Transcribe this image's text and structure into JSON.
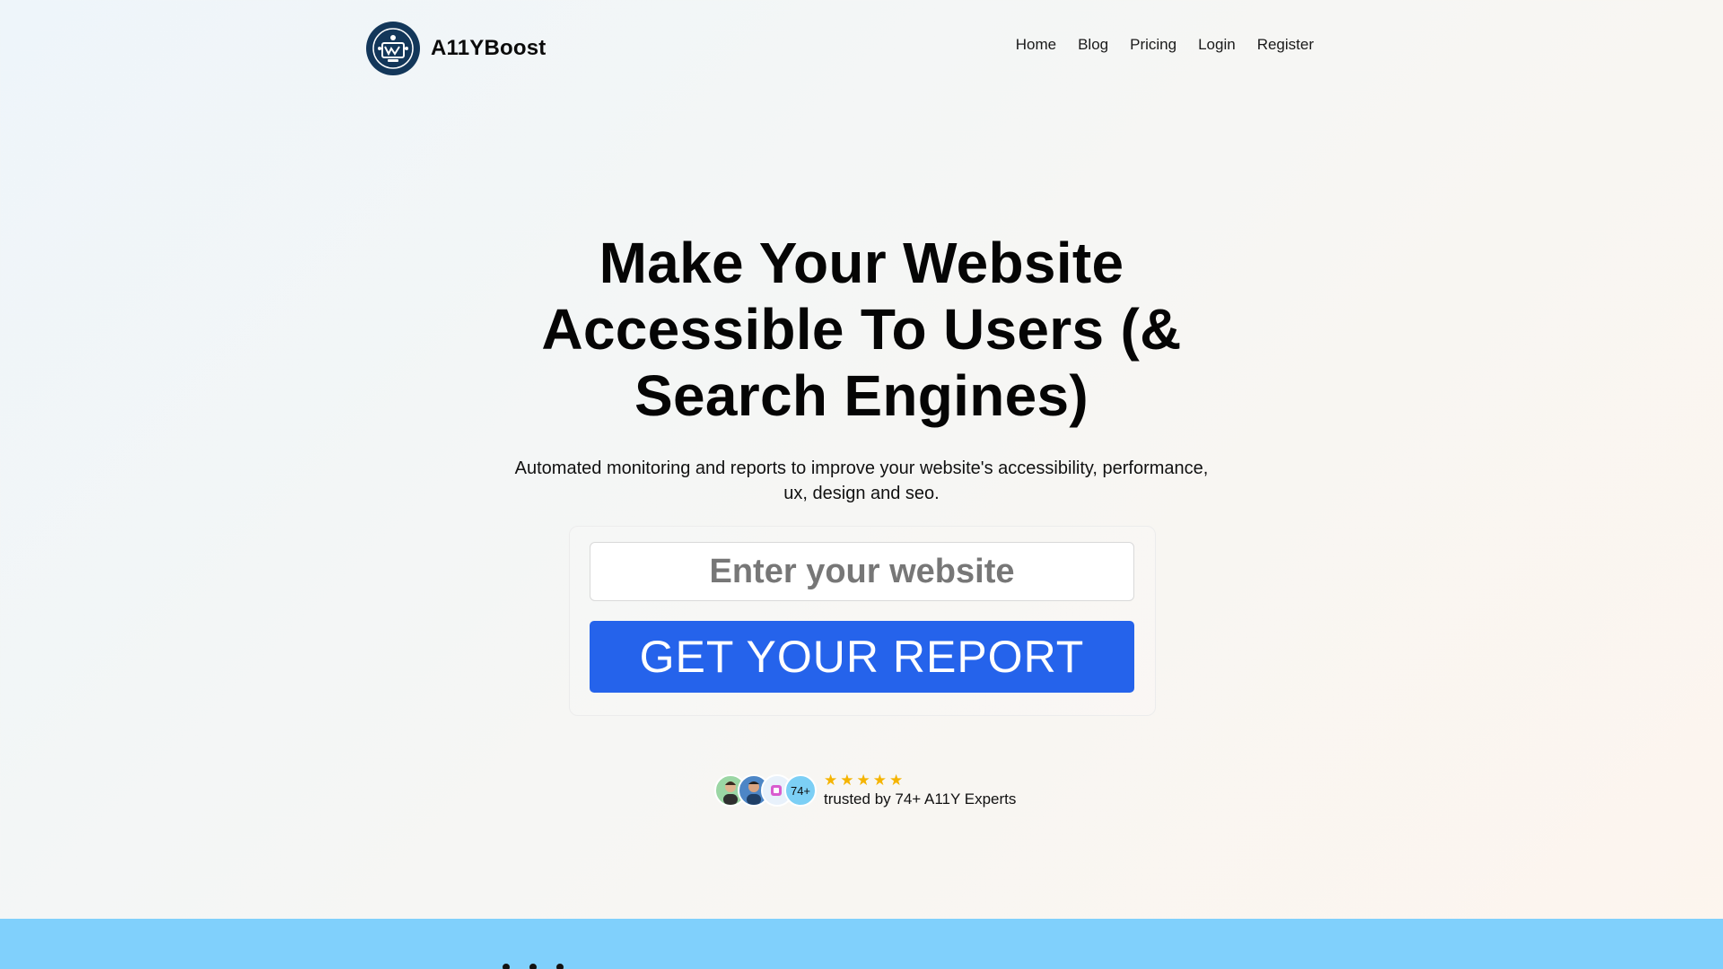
{
  "brand": {
    "name": "A11YBoost",
    "logo_icon": "accessibility-monitor-icon"
  },
  "nav": {
    "items": [
      {
        "label": "Home"
      },
      {
        "label": "Blog"
      },
      {
        "label": "Pricing"
      },
      {
        "label": "Login"
      },
      {
        "label": "Register"
      }
    ]
  },
  "hero": {
    "title": "Make Your Website Accessible To Users (& Search Engines)",
    "subtitle": "Automated monitoring and reports to improve your website's accessibility, performance, ux, design and seo."
  },
  "form": {
    "input_placeholder": "Enter your website",
    "input_value": "",
    "button_label": "GET YOUR REPORT"
  },
  "social_proof": {
    "avatar_count_label": "74+",
    "rating_stars": 5,
    "caption": "trusted by 74+ A11Y Experts"
  },
  "colors": {
    "primary_button": "#2563eb",
    "logo_bg": "#13375a",
    "band": "#80d0fc",
    "star": "#f5b400"
  }
}
